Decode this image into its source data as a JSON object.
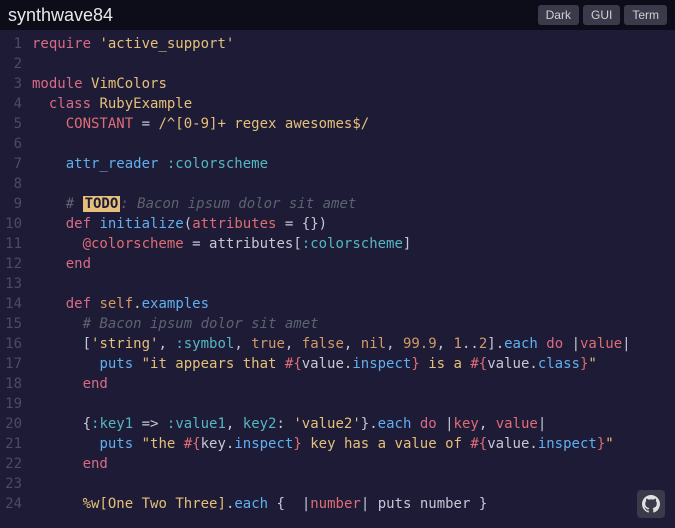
{
  "title": "synthwave84",
  "buttons": {
    "dark": "Dark",
    "gui": "GUI",
    "term": "Term"
  },
  "code": {
    "l1": {
      "require": "require",
      "str": "'active_support'"
    },
    "l3": {
      "module": "module",
      "name": "VimColors"
    },
    "l4": {
      "class": "class",
      "name": "RubyExample"
    },
    "l5": {
      "const": "CONSTANT",
      "eq": " = ",
      "rx": "/^[0-9]+ regex awesomes$/"
    },
    "l7": {
      "attr": "attr_reader",
      "sym": ":colorscheme"
    },
    "l9": {
      "hash": "# ",
      "todo": "TODO",
      "rest": ": Bacon ipsum dolor sit amet"
    },
    "l10": {
      "def": "def",
      "name": "initialize",
      "open": "(",
      "arg": "attributes",
      "eq": " = ",
      "empty": "{}",
      "close": ")"
    },
    "l11": {
      "ivar": "@colorscheme",
      "eq": " = ",
      "attr": "attributes",
      "open": "[",
      "sym": ":colorscheme",
      "close": "]"
    },
    "l12": {
      "end": "end"
    },
    "l14": {
      "def": "def",
      "self": "self",
      "dot": ".",
      "name": "examples"
    },
    "l15": {
      "cmt": "# Bacon ipsum dolor sit amet"
    },
    "l16": {
      "open": "[",
      "str": "'string'",
      "c1": ", ",
      "sym": ":symbol",
      "c2": ", ",
      "true": "true",
      "c3": ", ",
      "false": "false",
      "c4": ", ",
      "nil": "nil",
      "c5": ", ",
      "n1": "99.9",
      "c6": ", ",
      "r1": "1",
      "dots": "..",
      "r2": "2",
      "close": "]",
      "dot": ".",
      "each": "each",
      "do": "do",
      "pipe1": " |",
      "val": "value",
      "pipe2": "|"
    },
    "l17": {
      "puts": "puts",
      "s1": "\"it appears that ",
      "io1": "#{",
      "v1": "value",
      "d1": ".",
      "m1": "inspect",
      "ic1": "}",
      "s2": " is a ",
      "io2": "#{",
      "v2": "value",
      "d2": ".",
      "m2": "class",
      "ic2": "}",
      "s3": "\""
    },
    "l18": {
      "end": "end"
    },
    "l20": {
      "open": "{",
      "k1": ":key1",
      "arrow": " => ",
      "v1": ":value1",
      "c1": ", ",
      "k2": "key2",
      "colon": ": ",
      "v2": "'value2'",
      "close": "}",
      "dot": ".",
      "each": "each",
      "do": "do",
      "pipe1": " |",
      "key": "key",
      "c2": ", ",
      "val": "value",
      "pipe2": "|"
    },
    "l21": {
      "puts": "puts",
      "s1": "\"the ",
      "io1": "#{",
      "v1": "key",
      "d1": ".",
      "m1": "inspect",
      "ic1": "}",
      "s2": " key has a value of ",
      "io2": "#{",
      "v2": "value",
      "d2": ".",
      "m2": "inspect",
      "ic2": "}",
      "s3": "\""
    },
    "l22": {
      "end": "end"
    },
    "l24": {
      "pw": "%w[",
      "w1": "One",
      "sp1": " ",
      "w2": "Two",
      "sp2": " ",
      "w3": "Three",
      "close": "]",
      "dot": ".",
      "each": "each",
      "ob": " { ",
      "pipe1": " |",
      "num": "number",
      "pipe2": "|",
      "puts": " puts ",
      "numv": "number",
      "cb": " }"
    }
  }
}
